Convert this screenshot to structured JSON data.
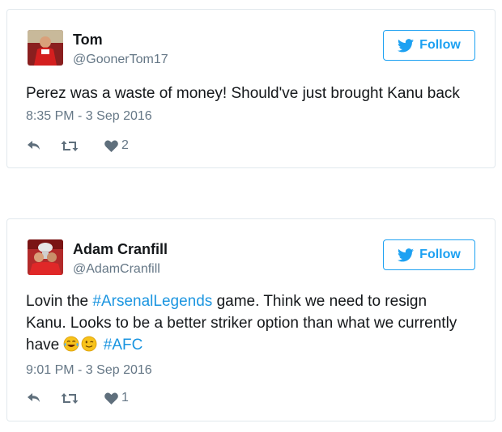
{
  "tweets": [
    {
      "name": "Tom",
      "handle": "@GoonerTom17",
      "follow_label": "Follow",
      "text": "Perez was a waste of money! Should've just brought Kanu back",
      "timestamp": "8:35 PM - 3 Sep 2016",
      "likes": "2"
    },
    {
      "name": "Adam Cranfill",
      "handle": "@AdamCranfill",
      "follow_label": "Follow",
      "text_before": "Lovin the ",
      "hashtag1": "#ArsenalLegends",
      "text_middle": " game. Think we need to resign Kanu. Looks to be a better striker option than what we currently have ",
      "emojis": [
        "tears-of-joy-emoji",
        "winking-face-emoji"
      ],
      "hashtag2": "#AFC",
      "timestamp": "9:01 PM - 3 Sep 2016",
      "likes": "1"
    }
  ],
  "colors": {
    "twitter_blue": "#1da1f2",
    "hashtag": "#1b95e0",
    "muted": "#657786",
    "border": "#e1e8ed"
  }
}
